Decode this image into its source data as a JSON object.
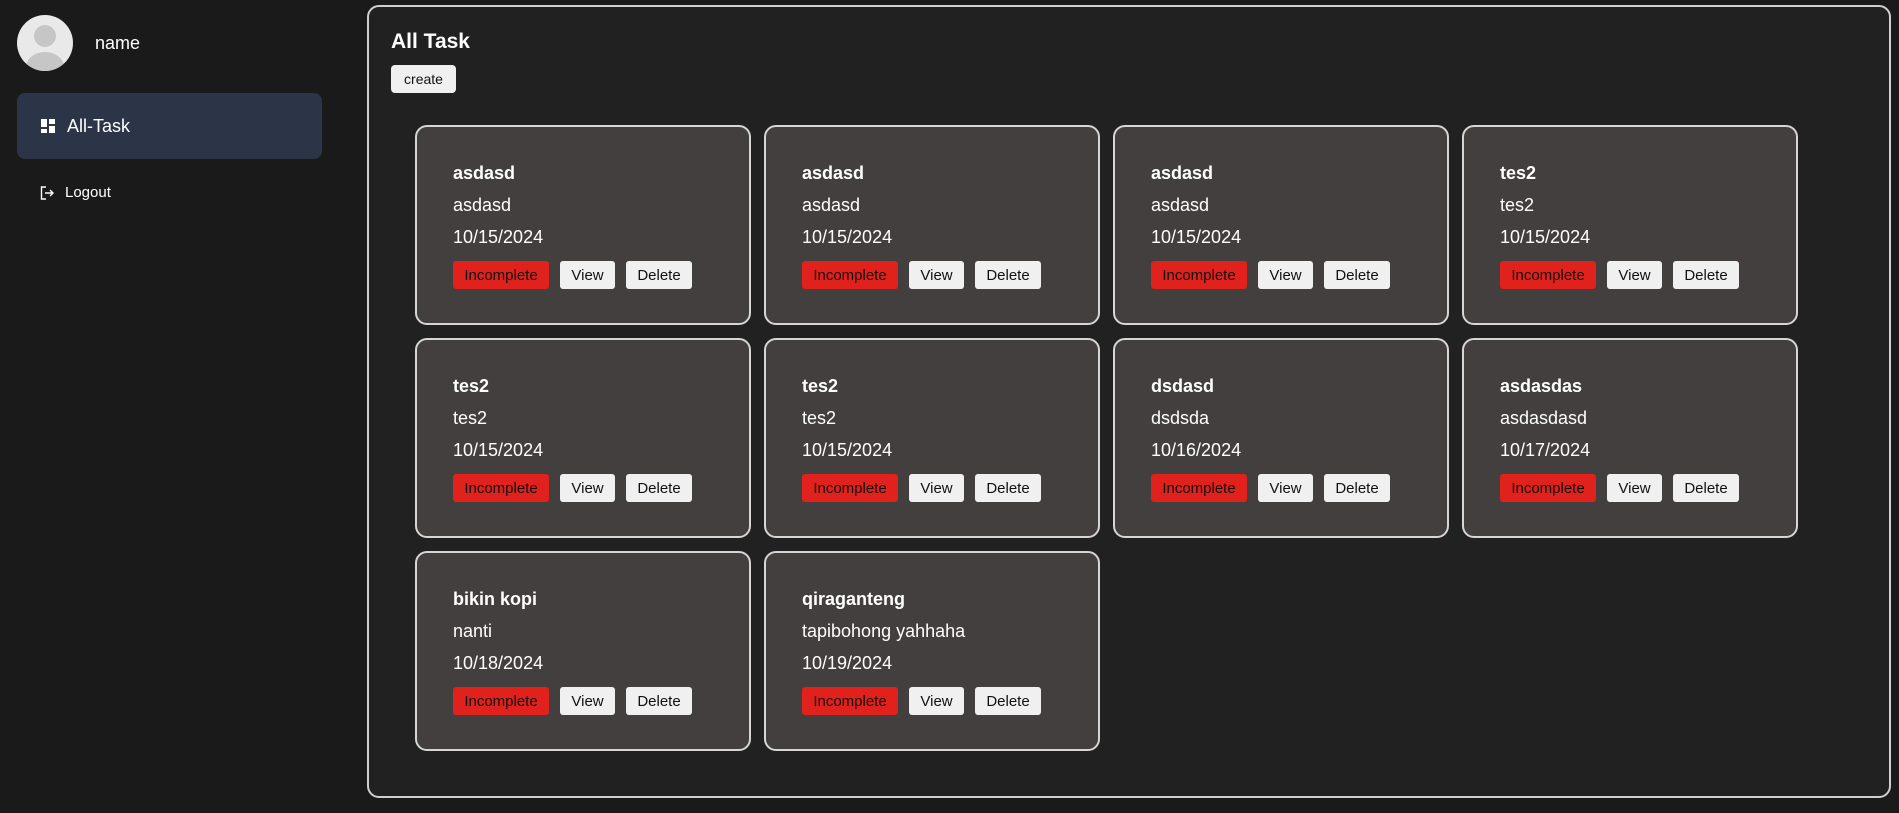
{
  "sidebar": {
    "profile_name": "name",
    "nav_all_task": "All-Task",
    "logout": "Logout"
  },
  "main": {
    "title": "All Task",
    "create_label": "create"
  },
  "tasks": [
    {
      "title": "asdasd",
      "description": "asdasd",
      "date": "10/15/2024",
      "status": "Incomplete",
      "view": "View",
      "delete": "Delete"
    },
    {
      "title": "asdasd",
      "description": "asdasd",
      "date": "10/15/2024",
      "status": "Incomplete",
      "view": "View",
      "delete": "Delete"
    },
    {
      "title": "asdasd",
      "description": "asdasd",
      "date": "10/15/2024",
      "status": "Incomplete",
      "view": "View",
      "delete": "Delete"
    },
    {
      "title": "tes2",
      "description": "tes2",
      "date": "10/15/2024",
      "status": "Incomplete",
      "view": "View",
      "delete": "Delete"
    },
    {
      "title": "tes2",
      "description": "tes2",
      "date": "10/15/2024",
      "status": "Incomplete",
      "view": "View",
      "delete": "Delete"
    },
    {
      "title": "tes2",
      "description": "tes2",
      "date": "10/15/2024",
      "status": "Incomplete",
      "view": "View",
      "delete": "Delete"
    },
    {
      "title": "dsdasd",
      "description": "dsdsda",
      "date": "10/16/2024",
      "status": "Incomplete",
      "view": "View",
      "delete": "Delete"
    },
    {
      "title": "asdasdas",
      "description": "asdasdasd",
      "date": "10/17/2024",
      "status": "Incomplete",
      "view": "View",
      "delete": "Delete"
    },
    {
      "title": "bikin kopi",
      "description": "nanti",
      "date": "10/18/2024",
      "status": "Incomplete",
      "view": "View",
      "delete": "Delete"
    },
    {
      "title": "qiraganteng",
      "description": "tapibohong yahhaha",
      "date": "10/19/2024",
      "status": "Incomplete",
      "view": "View",
      "delete": "Delete"
    }
  ],
  "colors": {
    "status_incomplete": "#e0211c",
    "nav_active": "#2c3547",
    "card_bg": "#433f3e"
  }
}
